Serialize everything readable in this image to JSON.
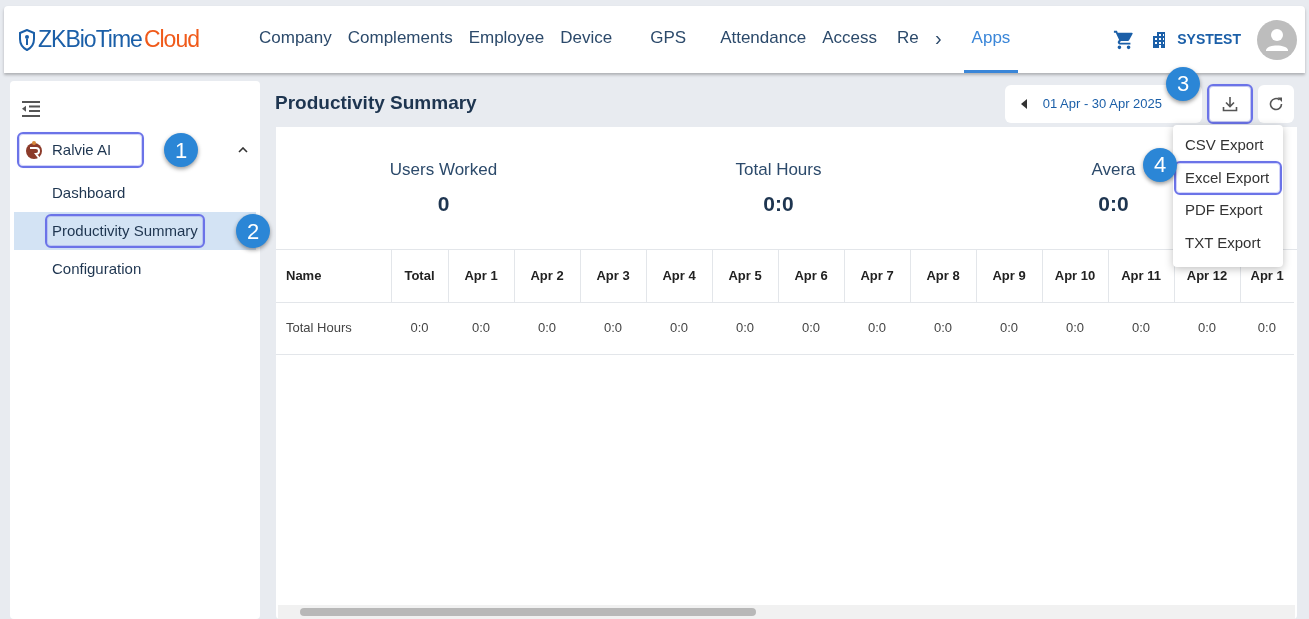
{
  "header": {
    "logo": {
      "main": "ZKBioTime",
      "accent": "Cloud"
    },
    "nav": [
      {
        "label": "Company",
        "selected": false
      },
      {
        "label": "Complements",
        "selected": false
      },
      {
        "label": "Employee",
        "selected": false
      },
      {
        "label": "Device",
        "selected": false
      },
      {
        "label": "GPS",
        "selected": false
      },
      {
        "label": "Attendance",
        "selected": false
      },
      {
        "label": "Access",
        "selected": false
      },
      {
        "label": "Re",
        "selected": false
      },
      {
        "label": "Apps",
        "selected": true
      }
    ],
    "more": "›",
    "company": "SYSTEST"
  },
  "sidebar": {
    "groups": [
      {
        "label": "Ralvie AI",
        "expanded": true,
        "highlighted": true,
        "callout": "1",
        "items": [
          {
            "label": "Dashboard",
            "selected": false,
            "highlighted": false
          },
          {
            "label": "Productivity Summary",
            "selected": true,
            "highlighted": true,
            "callout": "2"
          },
          {
            "label": "Configuration",
            "selected": false,
            "highlighted": false
          }
        ]
      }
    ]
  },
  "page": {
    "title": "Productivity Summary",
    "date_range": "01 Apr - 30 Apr 2025",
    "export": {
      "highlighted": true,
      "callout": "3",
      "menu": [
        {
          "label": "CSV Export",
          "highlighted": false
        },
        {
          "label": "Excel Export",
          "highlighted": true,
          "callout": "4"
        },
        {
          "label": "PDF Export",
          "highlighted": false
        },
        {
          "label": "TXT Export",
          "highlighted": false
        }
      ]
    },
    "stats": [
      {
        "label": "Users Worked",
        "value": "0"
      },
      {
        "label": "Total Hours",
        "value": "0:0"
      },
      {
        "label": "Avera",
        "value": "0:0"
      }
    ],
    "table": {
      "columns": [
        "Name",
        "Total",
        "Apr 1",
        "Apr 2",
        "Apr 3",
        "Apr 4",
        "Apr 5",
        "Apr 6",
        "Apr 7",
        "Apr 8",
        "Apr 9",
        "Apr 10",
        "Apr 11",
        "Apr 12",
        "Apr 1"
      ],
      "rows": [
        [
          "Total Hours",
          "0:0",
          "0:0",
          "0:0",
          "0:0",
          "0:0",
          "0:0",
          "0:0",
          "0:0",
          "0:0",
          "0:0",
          "0:0",
          "0:0",
          "0:0",
          "0:0"
        ]
      ]
    }
  }
}
